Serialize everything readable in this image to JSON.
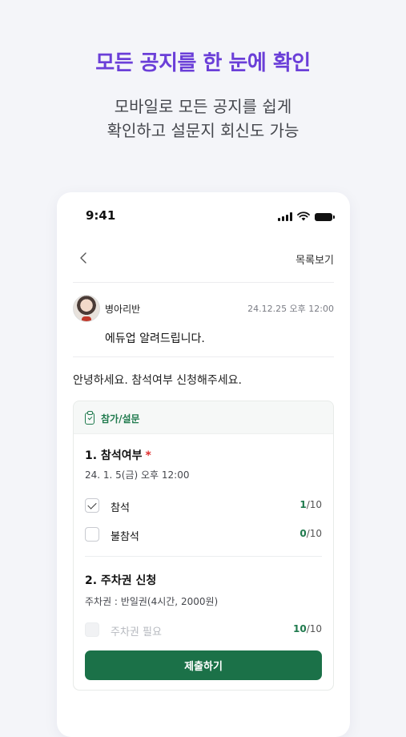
{
  "promo": {
    "headline": "모든 공지를 한 눈에 확인",
    "subline_1": "모바일로 모든 공지를 쉽게",
    "subline_2": "확인하고 설문지 회신도 가능"
  },
  "status_bar": {
    "time": "9:41"
  },
  "nav": {
    "back_icon": "chevron-left-icon",
    "list_label": "목록보기"
  },
  "post": {
    "author": "병아리반",
    "date": "24.12.25 오후 12:00",
    "title": "에듀업 알려드립니다.",
    "body": "안녕하세요. 참석여부 신청해주세요."
  },
  "survey": {
    "tag": "참가/설문",
    "q1": {
      "title": "1. 참석여부",
      "required_mark": "*",
      "description": "24. 1. 5(금) 오후 12:00",
      "options": [
        {
          "label": "참석",
          "checked": true,
          "count_current": "1",
          "count_total": "/10"
        },
        {
          "label": "불참석",
          "checked": false,
          "count_current": "0",
          "count_total": "/10"
        }
      ]
    },
    "q2": {
      "title": "2. 주차권 신청",
      "description": "주차권 : 반일권(4시간, 2000원)",
      "options": [
        {
          "label": "주차권 필요",
          "checked": false,
          "disabled": true,
          "count_current": "10",
          "count_total": "/10"
        }
      ]
    },
    "submit_label": "제출하기"
  },
  "colors": {
    "accent_purple": "#6b3fd8",
    "brand_green": "#1b7148",
    "required_red": "#e02f2f"
  }
}
